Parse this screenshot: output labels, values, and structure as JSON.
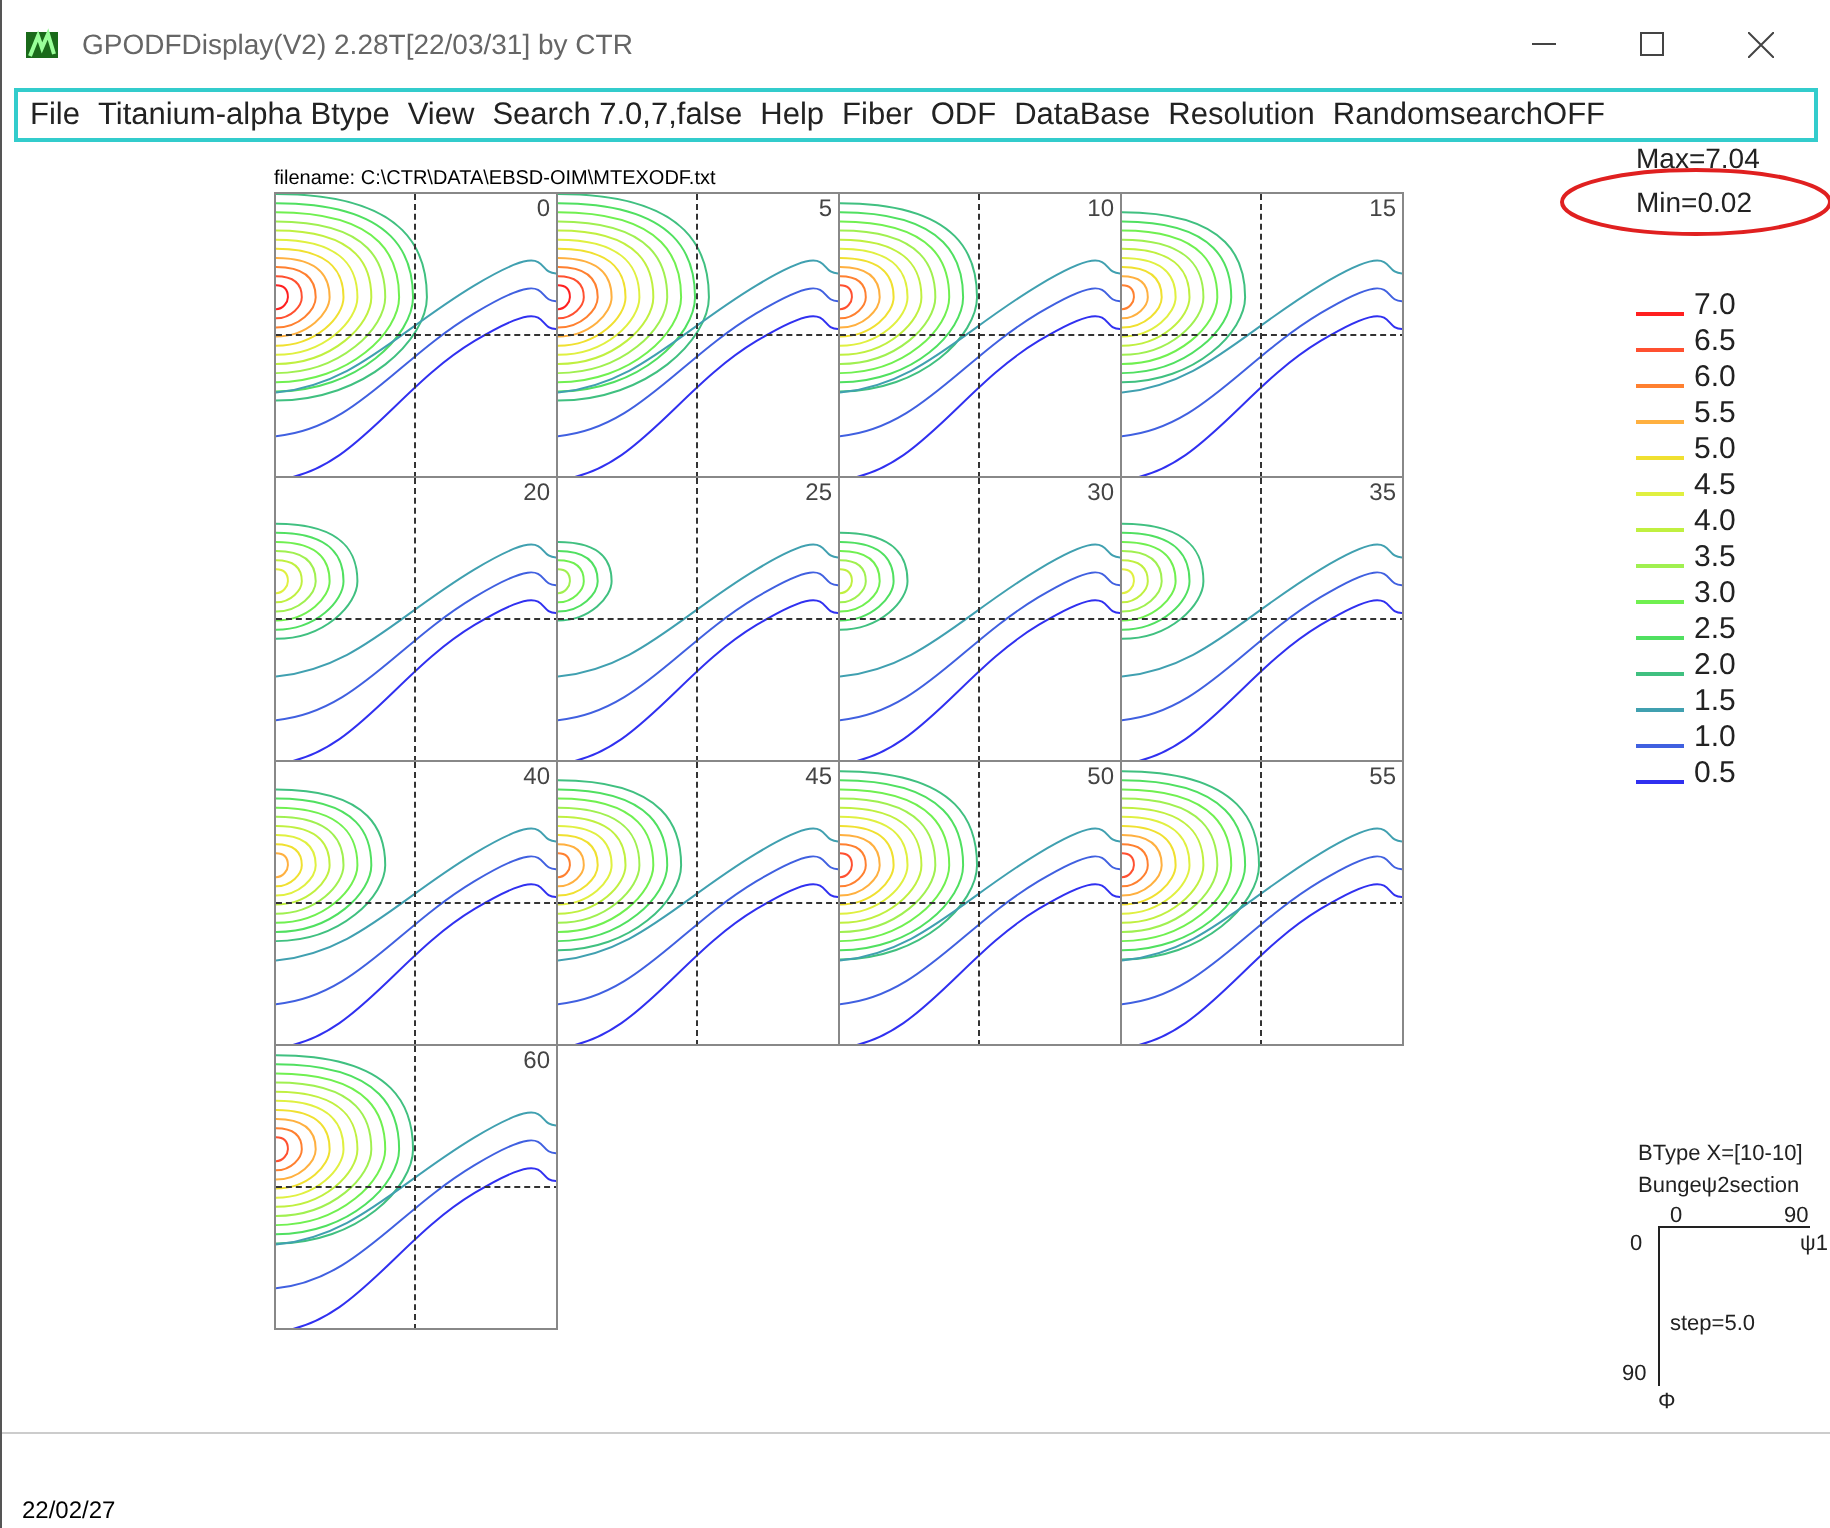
{
  "window": {
    "title": "GPODFDisplay(V2) 2.28T[22/03/31] by CTR"
  },
  "menu": [
    "File",
    "Titanium-alpha Btype",
    "View",
    "Search 7.0,7,false",
    "Help",
    "Fiber",
    "ODF",
    "DataBase",
    "Resolution",
    "RandomsearchOFF"
  ],
  "filename": "filename: C:\\CTR\\DATA\\EBSD-OIM\\MTEXODF.txt",
  "sections": [
    {
      "label": "0"
    },
    {
      "label": "5"
    },
    {
      "label": "10"
    },
    {
      "label": "15"
    },
    {
      "label": "20"
    },
    {
      "label": "25"
    },
    {
      "label": "30"
    },
    {
      "label": "35"
    },
    {
      "label": "40"
    },
    {
      "label": "45"
    },
    {
      "label": "50"
    },
    {
      "label": "55"
    },
    {
      "label": "60"
    }
  ],
  "stats": {
    "max": "Max=7.04",
    "min": "Min=0.02"
  },
  "legend": [
    {
      "label": "7.0",
      "color": "#ff2020"
    },
    {
      "label": "6.5",
      "color": "#ff5030"
    },
    {
      "label": "6.0",
      "color": "#ff8030"
    },
    {
      "label": "5.5",
      "color": "#ffb040"
    },
    {
      "label": "5.0",
      "color": "#f0e030"
    },
    {
      "label": "4.5",
      "color": "#e0f040"
    },
    {
      "label": "4.0",
      "color": "#c0f040"
    },
    {
      "label": "3.5",
      "color": "#a0f050"
    },
    {
      "label": "3.0",
      "color": "#70f050"
    },
    {
      "label": "2.5",
      "color": "#50e060"
    },
    {
      "label": "2.0",
      "color": "#40c080"
    },
    {
      "label": "1.5",
      "color": "#40a0b0"
    },
    {
      "label": "1.0",
      "color": "#4060e0"
    },
    {
      "label": "0.5",
      "color": "#3030f0"
    }
  ],
  "axes": {
    "type": "BType X=[10-10]",
    "section": "Bungeψ2section",
    "x_start": "0",
    "x_end": "90",
    "x_label": "ψ1",
    "y_start": "0",
    "y_end": "90",
    "y_label": "Φ",
    "step": "step=5.0"
  },
  "status": "22/02/27"
}
